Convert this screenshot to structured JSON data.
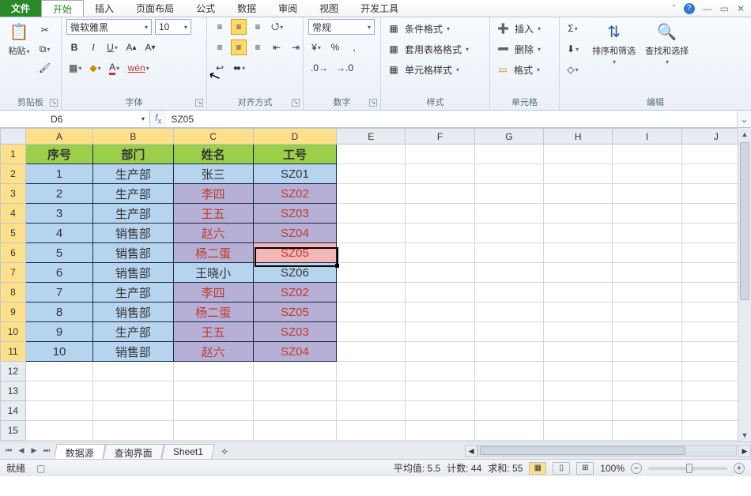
{
  "menu": {
    "file": "文件",
    "tabs": [
      "开始",
      "插入",
      "页面布局",
      "公式",
      "数据",
      "审阅",
      "视图",
      "开发工具"
    ],
    "active": 0
  },
  "ribbon": {
    "clipboard": {
      "label": "剪贴板",
      "paste": "粘贴"
    },
    "font": {
      "label": "字体",
      "name": "微软雅黑",
      "size": "10"
    },
    "align": {
      "label": "对齐方式"
    },
    "number": {
      "label": "数字",
      "format": "常规"
    },
    "style": {
      "label": "样式",
      "cond": "条件格式",
      "table": "套用表格格式",
      "cell": "单元格样式"
    },
    "cells": {
      "label": "单元格",
      "insert": "插入",
      "delete": "删除",
      "format": "格式"
    },
    "edit": {
      "label": "编辑",
      "sort": "排序和筛选",
      "find": "查找和选择"
    }
  },
  "fxbar": {
    "name": "D6",
    "fx": "SZ05"
  },
  "columns": [
    "A",
    "B",
    "C",
    "D",
    "E",
    "F",
    "G",
    "H",
    "I",
    "J"
  ],
  "selColsIdx": [
    0,
    1,
    2,
    3
  ],
  "headers": [
    "序号",
    "部门",
    "姓名",
    "工号"
  ],
  "rows": [
    {
      "n": "1",
      "a": "1",
      "b": "生产部",
      "c": "张三",
      "d": "SZ01",
      "cls": "blue"
    },
    {
      "n": "2",
      "a": "2",
      "b": "生产部",
      "c": "李四",
      "d": "SZ02",
      "cls": "purple"
    },
    {
      "n": "3",
      "a": "3",
      "b": "生产部",
      "c": "王五",
      "d": "SZ03",
      "cls": "purple"
    },
    {
      "n": "4",
      "a": "4",
      "b": "销售部",
      "c": "赵六",
      "d": "SZ04",
      "cls": "purple"
    },
    {
      "n": "5",
      "a": "5",
      "b": "销售部",
      "c": "杨二蛋",
      "d": "SZ05",
      "cls": "purple",
      "dcls": "pink"
    },
    {
      "n": "6",
      "a": "6",
      "b": "销售部",
      "c": "王晓小",
      "d": "SZ06",
      "cls": "blue"
    },
    {
      "n": "7",
      "a": "7",
      "b": "生产部",
      "c": "李四",
      "d": "SZ02",
      "cls": "purple"
    },
    {
      "n": "8",
      "a": "8",
      "b": "销售部",
      "c": "杨二蛋",
      "d": "SZ05",
      "cls": "purple"
    },
    {
      "n": "9",
      "a": "9",
      "b": "生产部",
      "c": "王五",
      "d": "SZ03",
      "cls": "purple"
    },
    {
      "n": "10",
      "a": "10",
      "b": "销售部",
      "c": "赵六",
      "d": "SZ04",
      "cls": "purple"
    }
  ],
  "blankRows": [
    "12",
    "13",
    "14",
    "15"
  ],
  "activeRowIdx": 5,
  "sheets": {
    "tabs": [
      "数据源",
      "查询界面",
      "Sheet1"
    ],
    "active": 0
  },
  "status": {
    "ready": "就绪",
    "avg_label": "平均值:",
    "avg": "5.5",
    "count_label": "计数:",
    "count": "44",
    "sum_label": "求和:",
    "sum": "55",
    "zoom": "100%"
  },
  "chart_data": null
}
